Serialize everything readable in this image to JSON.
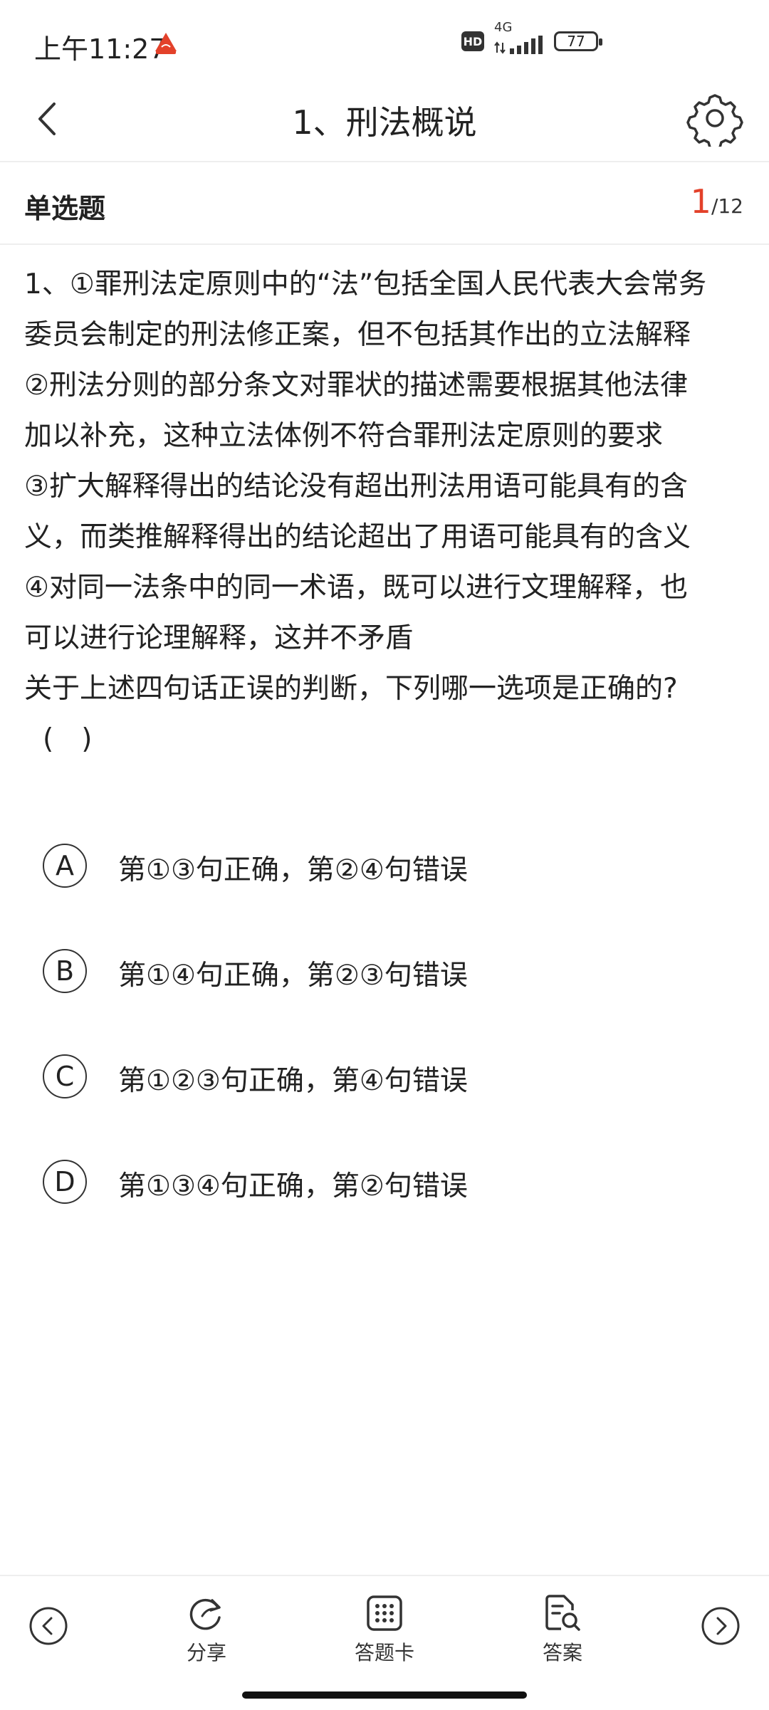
{
  "status_bar": {
    "time": "上午11:27",
    "hd": "HD",
    "network": "4G",
    "battery": "77"
  },
  "header": {
    "title": "1、刑法概说"
  },
  "question_meta": {
    "type_label": "单选题",
    "current": "1",
    "total": "/12"
  },
  "question": {
    "lines": [
      "1、①罪刑法定原则中的“法”包括全国人民代表大会常务",
      "委员会制定的刑法修正案，但不包括其作出的立法解释",
      "②刑法分则的部分条文对罪状的描述需要根据其他法律",
      "加以补充，这种立法体例不符合罪刑法定原则的要求",
      "③扩大解释得出的结论没有超出刑法用语可能具有的含",
      "义，而类推解释得出的结论超出了用语可能具有的含义",
      "④对同一法条中的同一术语，既可以进行文理解释，也",
      "可以进行论理解释，这并不矛盾",
      "关于上述四句话正误的判断，下列哪一选项是正确的?",
      "(　)"
    ]
  },
  "options": [
    {
      "letter": "A",
      "text": "第①③句正确，第②④句错误"
    },
    {
      "letter": "B",
      "text": "第①④句正确，第②③句错误"
    },
    {
      "letter": "C",
      "text": "第①②③句正确，第④句错误"
    },
    {
      "letter": "D",
      "text": "第①③④句正确，第②句错误"
    }
  ],
  "bottom_bar": {
    "share_label": "分享",
    "card_label": "答题卡",
    "answer_label": "答案"
  },
  "colors": {
    "accent": "#e3412a",
    "text": "#222222",
    "divider": "#eeeeee"
  }
}
